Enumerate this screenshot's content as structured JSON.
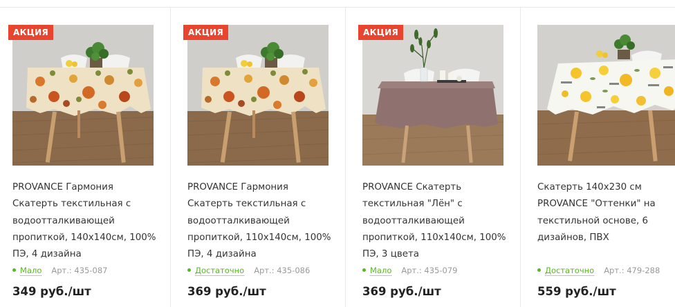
{
  "products": [
    {
      "badge": "АКЦИЯ",
      "title": "PROVANCE Гармония Скатерть текстильная с водоотталкивающей пропиткой, 140х140см, 100% ПЭ, 4 дизайна",
      "stock": "Мало",
      "article": "Арт.: 435-087",
      "price": "349 руб./шт",
      "image": "floral-tablecloth-photo"
    },
    {
      "badge": "АКЦИЯ",
      "title": "PROVANCE Гармония Скатерть текстильная с водоотталкивающей пропиткой, 110х140см, 100% ПЭ, 4 дизайна",
      "stock": "Достаточно",
      "article": "Арт.: 435-086",
      "price": "369 руб./шт",
      "image": "floral-tablecloth-photo"
    },
    {
      "badge": "АКЦИЯ",
      "title": "PROVANCE Скатерть текстильная \"Лён\" с водоотталкивающей пропиткой, 110х140см, 100% ПЭ, 3 цвета",
      "stock": "Мало",
      "article": "Арт.: 435-079",
      "price": "369 руб./шт",
      "image": "linen-tablecloth-photo"
    },
    {
      "badge": "",
      "title": "Скатерть 140х230 см PROVANCE \"Оттенки\" на текстильной основе, 6 дизайнов, ПВХ",
      "stock": "Достаточно",
      "article": "Арт.: 479-288",
      "price": "559 руб./шт",
      "image": "lemon-tablecloth-photo"
    }
  ],
  "colors": {
    "badge": "#e9442d",
    "stock": "#5bb52a",
    "article": "#999999",
    "price": "#222222"
  }
}
